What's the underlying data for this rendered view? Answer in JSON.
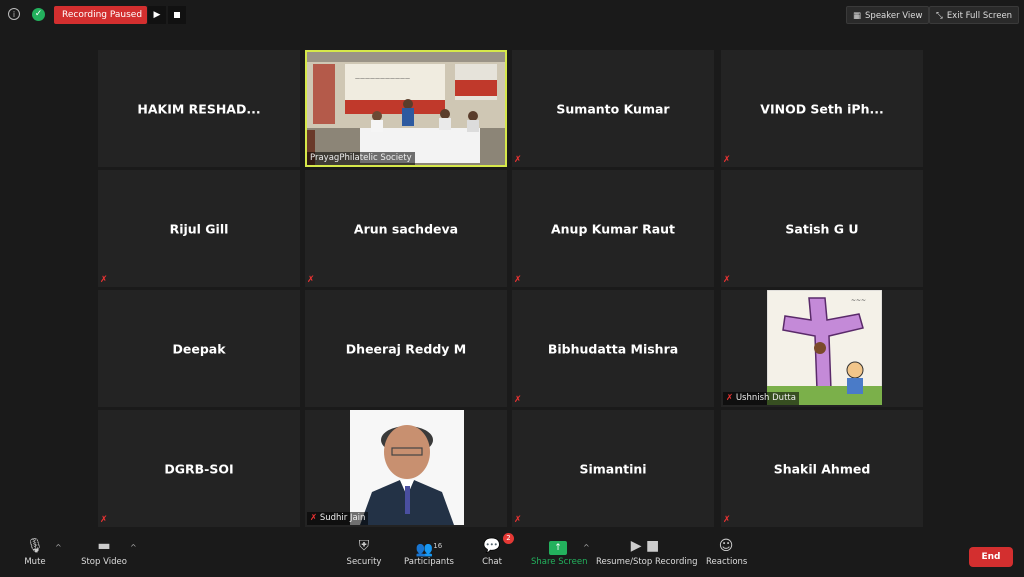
{
  "topbar": {
    "recording_status": "Recording Paused",
    "speaker_view_label": "Speaker View",
    "exit_full_screen_label": "Exit Full Screen"
  },
  "participants": [
    {
      "name": "HAKIM  RESHAD...",
      "muted": false,
      "has_video": false
    },
    {
      "name": "PrayagPhilatelic Society",
      "muted": false,
      "has_video": true,
      "video_content": "conference room scene",
      "active_speaker": true
    },
    {
      "name": "Sumanto Kumar",
      "muted": true,
      "has_video": false
    },
    {
      "name": "VINOD Seth iPh...",
      "muted": true,
      "has_video": false
    },
    {
      "name": "Rijul Gill",
      "muted": true,
      "has_video": false
    },
    {
      "name": "Arun sachdeva",
      "muted": true,
      "has_video": false
    },
    {
      "name": "Anup Kumar Raut",
      "muted": true,
      "has_video": false
    },
    {
      "name": "Satish G U",
      "muted": true,
      "has_video": false
    },
    {
      "name": "Deepak",
      "muted": false,
      "has_video": false
    },
    {
      "name": "Dheeraj Reddy M",
      "muted": false,
      "has_video": false
    },
    {
      "name": "Bibhudatta Mishra",
      "muted": true,
      "has_video": false
    },
    {
      "name": "Ushnish Dutta",
      "muted": true,
      "has_video": true,
      "video_content": "cartoon illustration"
    },
    {
      "name": "DGRB-SOI",
      "muted": true,
      "has_video": false
    },
    {
      "name": "Sudhir Jain",
      "muted": true,
      "has_video": true,
      "video_content": "portrait photo"
    },
    {
      "name": "Simantini",
      "muted": true,
      "has_video": false
    },
    {
      "name": "Shakil Ahmed",
      "muted": true,
      "has_video": false
    }
  ],
  "toolbar": {
    "mute_label": "Mute",
    "stop_video_label": "Stop Video",
    "security_label": "Security",
    "participants_label": "Participants",
    "participants_count": "16",
    "chat_label": "Chat",
    "chat_badge": "2",
    "share_screen_label": "Share Screen",
    "recording_label": "Resume/Stop Recording",
    "reactions_label": "Reactions",
    "end_label": "End"
  },
  "colors": {
    "recording_red": "#d32f2f",
    "active_speaker": "#d6e84a",
    "share_green": "#23b15d",
    "tile_bg": "#232323",
    "muted_icon": "#e33333"
  }
}
